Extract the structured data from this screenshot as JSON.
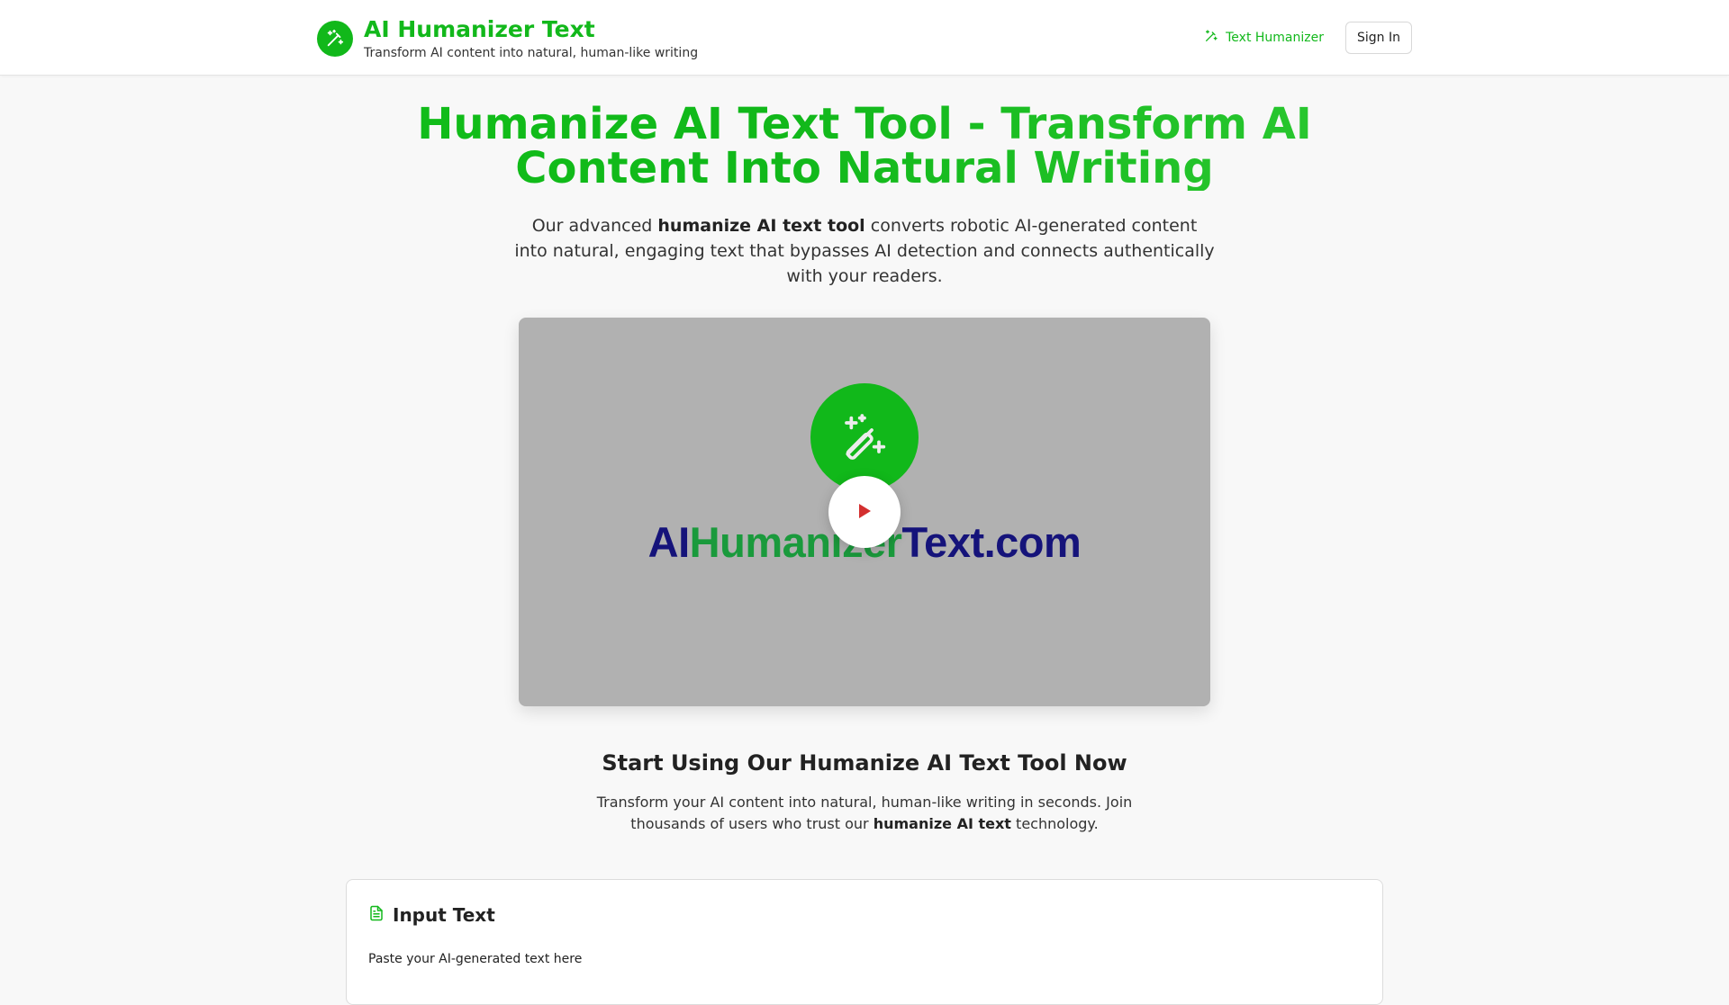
{
  "header": {
    "title": "AI Humanizer Text",
    "subtitle": "Transform AI content into natural, human-like writing",
    "nav_link": "Text Humanizer",
    "sign_in": "Sign In"
  },
  "hero": {
    "title_line1": "Humanize AI Text Tool - Transform AI",
    "title_line2": "Content Into Natural Writing",
    "desc_pre": "Our advanced ",
    "desc_bold": "humanize AI text tool",
    "desc_post": " converts robotic AI-generated content into natural, engaging text that bypasses AI detection and connects authentically with your readers."
  },
  "video": {
    "brand_p1": "AI",
    "brand_p2": "Humanizer",
    "brand_p3": "Text.com"
  },
  "start": {
    "title": "Start Using Our Humanize AI Text Tool Now",
    "desc_pre": "Transform your AI content into natural, human-like writing in seconds. Join thousands of users who trust our ",
    "desc_bold": "humanize AI text",
    "desc_post": " technology."
  },
  "input_card": {
    "title": "Input Text",
    "label": "Paste your AI-generated text here"
  },
  "colors": {
    "brand_green": "#11b81a",
    "video_bg": "#b1b1b1",
    "play_icon": "#d32f2f",
    "brand_navy": "#15137a"
  },
  "icons": {
    "logo": "magic-wand-icon",
    "nav": "magic-wand-icon",
    "play": "play-icon",
    "card": "document-icon"
  }
}
